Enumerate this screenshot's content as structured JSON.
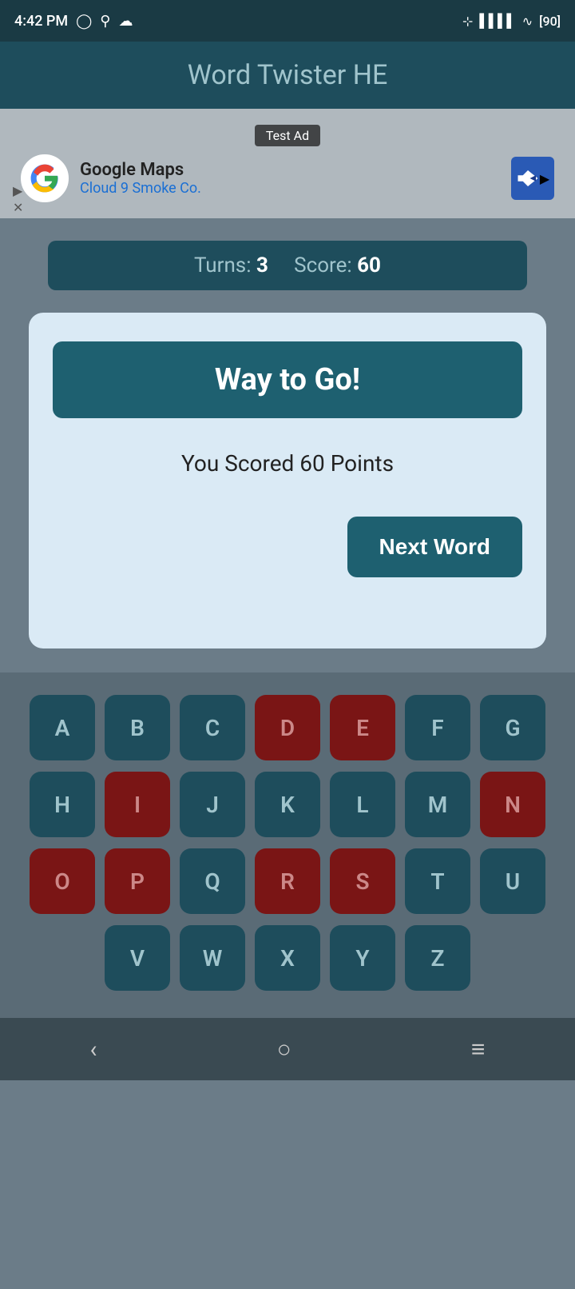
{
  "statusBar": {
    "time": "4:42 PM",
    "battery": "90"
  },
  "header": {
    "title": "Word Twister HE"
  },
  "ad": {
    "label": "Test Ad",
    "company": "Google Maps",
    "sub": "Cloud 9 Smoke Co."
  },
  "game": {
    "turnsLabel": "Turns:",
    "turnsValue": "3",
    "scoreLabel": "Score:",
    "scoreValue": "60"
  },
  "dialog": {
    "titleText": "Way to Go!",
    "scoreText": "You Scored 60 Points",
    "nextWordBtn": "Next Word"
  },
  "keyboard": {
    "rows": [
      [
        {
          "letter": "A",
          "used": false
        },
        {
          "letter": "B",
          "used": false
        },
        {
          "letter": "C",
          "used": false
        },
        {
          "letter": "D",
          "used": true
        },
        {
          "letter": "E",
          "used": true
        },
        {
          "letter": "F",
          "used": false
        },
        {
          "letter": "G",
          "used": false
        }
      ],
      [
        {
          "letter": "H",
          "used": false
        },
        {
          "letter": "I",
          "used": true
        },
        {
          "letter": "J",
          "used": false
        },
        {
          "letter": "K",
          "used": false
        },
        {
          "letter": "L",
          "used": false
        },
        {
          "letter": "M",
          "used": false
        },
        {
          "letter": "N",
          "used": true
        }
      ],
      [
        {
          "letter": "O",
          "used": true
        },
        {
          "letter": "P",
          "used": true
        },
        {
          "letter": "Q",
          "used": false
        },
        {
          "letter": "R",
          "used": true
        },
        {
          "letter": "S",
          "used": true
        },
        {
          "letter": "T",
          "used": false
        },
        {
          "letter": "U",
          "used": false
        }
      ],
      [
        {
          "letter": "V",
          "used": false
        },
        {
          "letter": "W",
          "used": false
        },
        {
          "letter": "X",
          "used": false
        },
        {
          "letter": "Y",
          "used": false
        },
        {
          "letter": "Z",
          "used": false
        }
      ]
    ]
  },
  "navBar": {
    "backLabel": "‹",
    "homeLabel": "○",
    "menuLabel": "≡"
  }
}
